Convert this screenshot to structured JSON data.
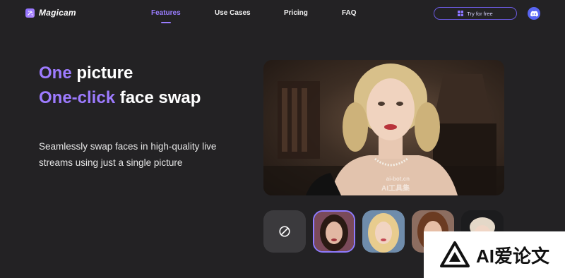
{
  "nav": {
    "logo_text": "Magicam",
    "items": [
      {
        "label": "Features",
        "active": true
      },
      {
        "label": "Use Cases",
        "active": false
      },
      {
        "label": "Pricing",
        "active": false
      },
      {
        "label": "FAQ",
        "active": false
      }
    ],
    "try_button": "Try for free",
    "try_icon": "windows-icon",
    "discord_icon": "discord-icon"
  },
  "hero": {
    "line1_accent": "One",
    "line1_rest": " picture",
    "line2_accent": "One-click",
    "line2_rest": " face swap",
    "desc_line1": "Seamlessly swap faces in high-quality live",
    "desc_line2": "streams using just a single picture"
  },
  "preview": {
    "watermark_top": "ai-bot.cn",
    "watermark_bottom": "AI工具集"
  },
  "faces": {
    "none_icon": "no-symbol-icon",
    "items": [
      "face-option-1",
      "face-option-2",
      "face-option-3",
      "face-option-4"
    ],
    "selected_index": 0
  },
  "badge": {
    "text": "AI爱论文"
  },
  "colors": {
    "background": "#232224",
    "accent": "#9d7bff",
    "discord": "#5865f2"
  }
}
